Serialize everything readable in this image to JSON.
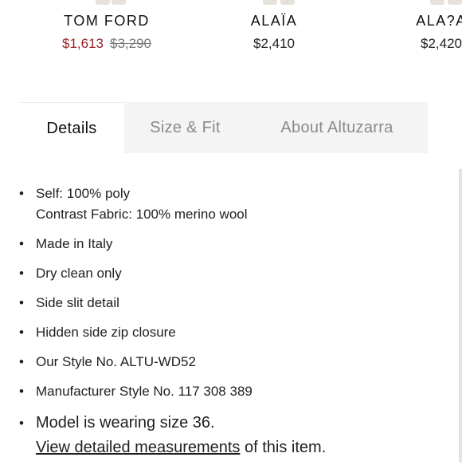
{
  "carousel": {
    "products": [
      {
        "brand": "TOM FORD",
        "sale_price": "$1,613",
        "original_price": "$3,290"
      },
      {
        "brand": "ALAÏA",
        "price": "$2,410"
      },
      {
        "brand": "ALA?A",
        "price": "$2,420"
      }
    ],
    "sale_color": "#9b2226"
  },
  "tabs": [
    {
      "label": "Details",
      "active": true
    },
    {
      "label": "Size & Fit",
      "active": false
    },
    {
      "label": "About Altuzarra",
      "active": false
    }
  ],
  "details": {
    "items": [
      {
        "line1": "Self: 100% poly",
        "line2": "Contrast Fabric: 100% merino wool"
      },
      {
        "text": "Made in Italy"
      },
      {
        "text": "Dry clean only"
      },
      {
        "text": "Side slit detail"
      },
      {
        "text": "Hidden side zip closure"
      },
      {
        "text": "Our Style No. ALTU-WD52"
      },
      {
        "text": "Manufacturer Style No. 117 308 389"
      }
    ],
    "model_note": "Model is wearing size 36.",
    "measurements_link": "View detailed measurements",
    "measurements_suffix": "of this item."
  }
}
